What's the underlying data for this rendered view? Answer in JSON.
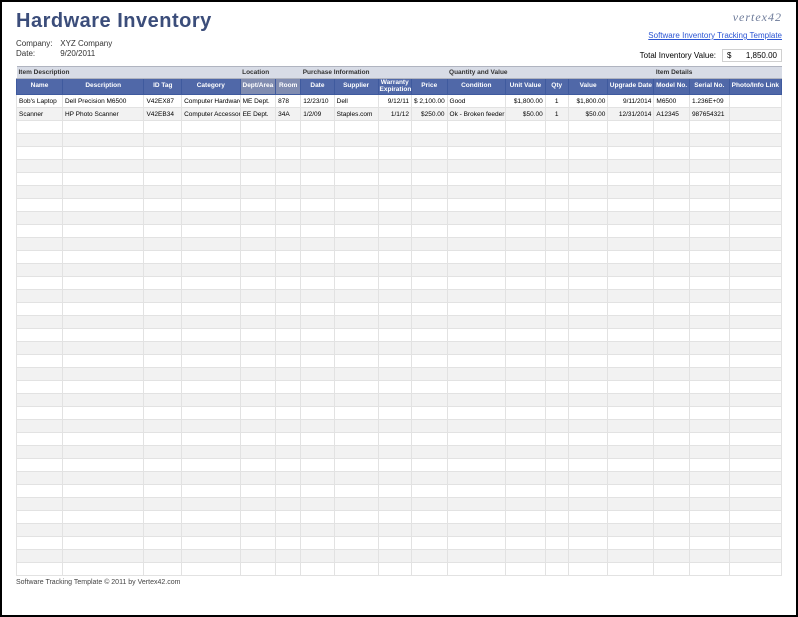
{
  "header": {
    "title": "Hardware Inventory",
    "logo_text": "vertex42",
    "logo_link": "Software Inventory Tracking Template",
    "company_label": "Company:",
    "company_value": "XYZ Company",
    "date_label": "Date:",
    "date_value": "9/20/2011",
    "total_label": "Total Inventory Value:",
    "total_currency": "$",
    "total_value": "1,850.00"
  },
  "groups": {
    "item_desc": "Item Description",
    "location": "Location",
    "purchase": "Purchase Information",
    "qty_value": "Quantity and Value",
    "item_details": "Item Details"
  },
  "columns": {
    "name": "Name",
    "description": "Description",
    "id_tag": "ID Tag",
    "category": "Category",
    "dept": "Dept/Area",
    "room": "Room",
    "date": "Date",
    "supplier": "Supplier",
    "warranty": "Warranty Expiration",
    "price": "Price",
    "condition": "Condition",
    "unit_value": "Unit Value",
    "qty": "Qty",
    "value": "Value",
    "upgrade": "Upgrade Date",
    "model": "Model No.",
    "serial": "Serial No.",
    "photo": "Photo/Info Link"
  },
  "rows": [
    {
      "name": "Bob's Laptop",
      "description": "Dell Precision M6500",
      "id_tag": "V42EX87",
      "category": "Computer Hardware",
      "dept": "ME Dept.",
      "room": "878",
      "date": "12/23/10",
      "supplier": "Dell",
      "warranty": "9/12/11",
      "price": "$  2,100.00",
      "condition": "Good",
      "unit_value": "$1,800.00",
      "qty": "1",
      "value": "$1,800.00",
      "upgrade": "9/11/2014",
      "model": "M6500",
      "serial": "1.236E+09",
      "photo": ""
    },
    {
      "name": "Scanner",
      "description": "HP Photo Scanner",
      "id_tag": "V42EB34",
      "category": "Computer Accessories",
      "dept": "EE Dept.",
      "room": "34A",
      "date": "1/2/09",
      "supplier": "Staples.com",
      "warranty": "1/1/12",
      "price": "$250.00",
      "condition": "Ok - Broken feeder",
      "unit_value": "$50.00",
      "qty": "1",
      "value": "$50.00",
      "upgrade": "12/31/2014",
      "model": "A12345",
      "serial": "987654321",
      "photo": ""
    }
  ],
  "empty_row_count": 35,
  "footer": {
    "text": "Software Tracking Template © 2011 by Vertex42.com"
  }
}
